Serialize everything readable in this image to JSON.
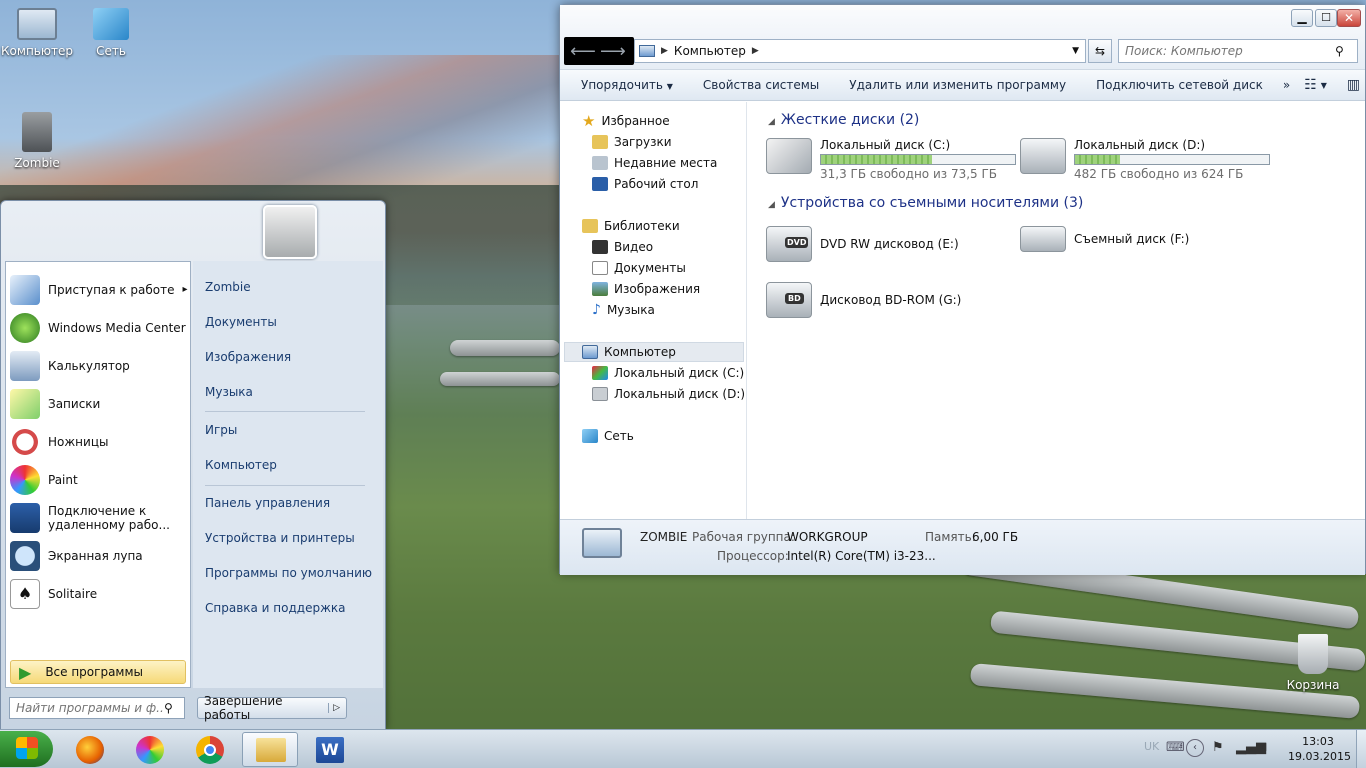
{
  "desktop": {
    "icons": [
      {
        "label": "Компьютер"
      },
      {
        "label": "Сеть"
      },
      {
        "label": "Zombie"
      },
      {
        "label": "Корзина"
      }
    ]
  },
  "start_menu": {
    "programs": [
      {
        "label": "Приступая к работе",
        "arrow": "▸"
      },
      {
        "label": "Windows Media Center"
      },
      {
        "label": "Калькулятор"
      },
      {
        "label": "Записки"
      },
      {
        "label": "Ножницы"
      },
      {
        "label": "Paint"
      },
      {
        "label": "Подключение к удаленному рабо..."
      },
      {
        "label": "Экранная лупа"
      },
      {
        "label": "Solitaire"
      }
    ],
    "all_programs": "Все программы",
    "search_placeholder": "Найти программы и ф...",
    "shutdown": "Завершение работы",
    "right": [
      "Zombie",
      "Документы",
      "Изображения",
      "Музыка",
      "Игры",
      "Компьютер",
      "Панель управления",
      "Устройства и принтеры",
      "Программы по умолчанию",
      "Справка и поддержка"
    ]
  },
  "explorer": {
    "address": "Компьютер",
    "search_placeholder": "Поиск: Компьютер",
    "commands": [
      "Упорядочить",
      "Свойства системы",
      "Удалить или изменить программу",
      "Подключить сетевой диск",
      "»"
    ],
    "nav": {
      "favorites": "Избранное",
      "downloads": "Загрузки",
      "recent": "Недавние места",
      "desktop": "Рабочий стол",
      "libraries": "Библиотеки",
      "video": "Видео",
      "documents": "Документы",
      "images": "Изображения",
      "music": "Музыка",
      "computer": "Компьютер",
      "disk_c": "Локальный диск (C:)",
      "disk_d": "Локальный диск (D:)",
      "network": "Сеть"
    },
    "hard_disks": {
      "title": "Жесткие диски (2)",
      "items": [
        {
          "name": "Локальный диск (C:)",
          "free": "31,3 ГБ свободно из 73,5 ГБ",
          "used_fraction": 0.57
        },
        {
          "name": "Локальный диск (D:)",
          "free": "482 ГБ свободно из 624 ГБ",
          "used_fraction": 0.23
        }
      ]
    },
    "removable": {
      "title": "Устройства со съемными носителями (3)",
      "items": [
        {
          "name": "DVD RW дисковод (E:)",
          "badge": "DVD"
        },
        {
          "name": "Съемный диск (F:)"
        },
        {
          "name": "Дисковод BD-ROM (G:)",
          "badge": "BD"
        }
      ]
    },
    "details": {
      "name": "ZOMBIE",
      "workgroup_label": "Рабочая группа:",
      "workgroup": "WORKGROUP",
      "memory_label": "Память:",
      "memory": "6,00 ГБ",
      "cpu_label": "Процессор:",
      "cpu": "Intel(R) Core(TM) i3-23..."
    }
  },
  "tray": {
    "lang": "UK",
    "time": "13:03",
    "date": "19.03.2015"
  }
}
